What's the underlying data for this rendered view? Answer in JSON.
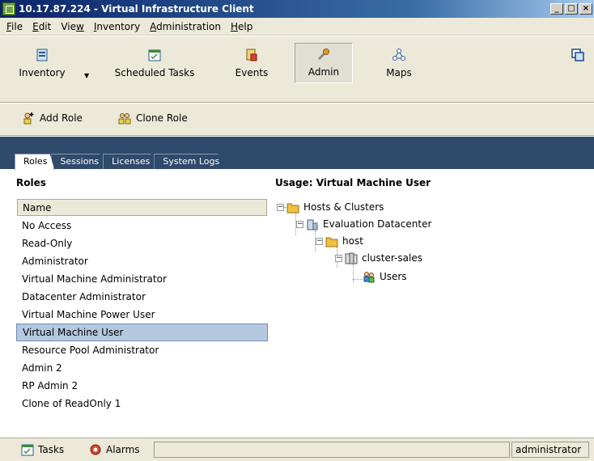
{
  "window": {
    "title": "10.17.87.224 - Virtual Infrastructure Client",
    "minimize": "_",
    "maximize": "□",
    "close": "×"
  },
  "menu": [
    {
      "label": "File",
      "key": "F",
      "rest": "ile"
    },
    {
      "label": "Edit",
      "key": "E",
      "rest": "dit"
    },
    {
      "label": "View",
      "pre": "Vie",
      "key": "w",
      "rest": ""
    },
    {
      "label": "Inventory",
      "key": "I",
      "rest": "nventory"
    },
    {
      "label": "Administration",
      "key": "A",
      "rest": "dministration"
    },
    {
      "label": "Help",
      "key": "H",
      "rest": "elp"
    }
  ],
  "nav": {
    "inventory": "Inventory",
    "scheduled_tasks": "Scheduled Tasks",
    "events": "Events",
    "admin": "Admin",
    "maps": "Maps"
  },
  "actions": {
    "add_role": "Add Role",
    "clone_role": "Clone Role"
  },
  "tabs": [
    "Roles",
    "Sessions",
    "Licenses",
    "System Logs"
  ],
  "roles": {
    "title": "Roles",
    "column": "Name",
    "items": [
      "No Access",
      "Read-Only",
      "Administrator",
      "Virtual Machine Administrator",
      "Datacenter Administrator",
      "Virtual Machine Power User",
      "Virtual Machine User",
      "Resource Pool Administrator",
      "Admin 2",
      "RP Admin 2",
      "Clone of ReadOnly 1"
    ],
    "selected": "Virtual Machine User"
  },
  "usage": {
    "title": "Usage: Virtual Machine User",
    "tree": [
      "Hosts & Clusters",
      "Evaluation Datacenter",
      "host",
      "cluster-sales",
      "Users"
    ]
  },
  "status": {
    "tasks": "Tasks",
    "alarms": "Alarms",
    "user": "administrator"
  },
  "colors": {
    "titlebar": "#0a246a",
    "band": "#2f4a6a",
    "selection": "#b4c8e0",
    "chrome": "#ece9d8"
  }
}
